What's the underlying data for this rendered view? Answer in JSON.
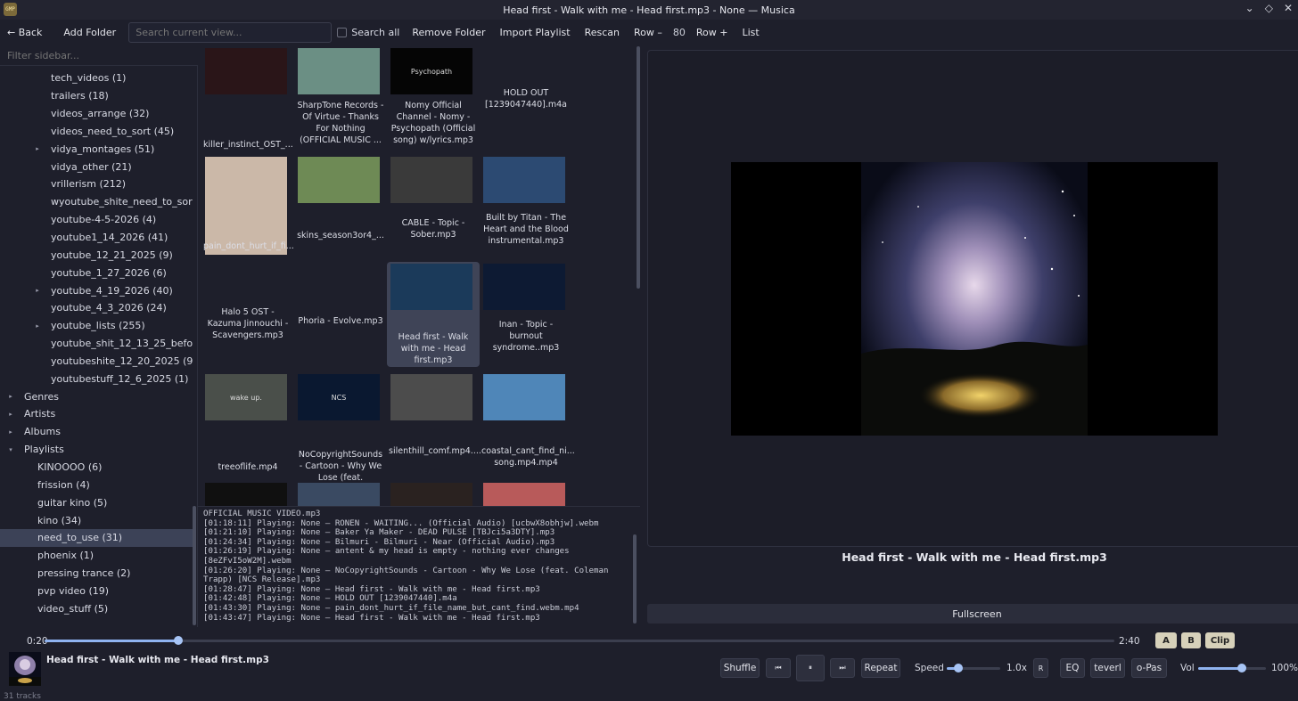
{
  "window": {
    "title": "Head first - Walk with me - Head first.mp3 - None — Musica",
    "app_icon_label": "GMP"
  },
  "toolbar": {
    "back": "← Back",
    "add_folder": "Add Folder",
    "search_placeholder": "Search current view...",
    "search_all": "Search all",
    "remove_folder": "Remove Folder",
    "import_playlist": "Import Playlist",
    "rescan": "Rescan",
    "row_minus": "Row –",
    "row_count": "80",
    "row_plus": "Row +",
    "list": "List"
  },
  "sidebar": {
    "filter_placeholder": "Filter sidebar...",
    "items": [
      {
        "label": "tech_videos (1)"
      },
      {
        "label": "trailers (18)"
      },
      {
        "label": "videos_arrange (32)"
      },
      {
        "label": "videos_need_to_sort (45)"
      },
      {
        "label": "vidya_montages (51)"
      },
      {
        "label": "vidya_other (21)"
      },
      {
        "label": "vrillerism (212)"
      },
      {
        "label": "wyoutube_shite_need_to_sort..."
      },
      {
        "label": "youtube-4-5-2026 (4)"
      },
      {
        "label": "youtube1_14_2026 (41)"
      },
      {
        "label": "youtube_12_21_2025 (9)"
      },
      {
        "label": "youtube_1_27_2026 (6)"
      },
      {
        "label": "youtube_4_19_2026 (40)"
      },
      {
        "label": "youtube_4_3_2026 (24)"
      },
      {
        "label": "youtube_lists (255)"
      },
      {
        "label": "youtube_shit_12_13_25_befor..."
      },
      {
        "label": "youtubeshite_12_20_2025 (9)"
      },
      {
        "label": "youtubestuff_12_6_2025 (1)"
      },
      {
        "label": "Genres"
      },
      {
        "label": "Artists"
      },
      {
        "label": "Albums"
      },
      {
        "label": "Playlists"
      },
      {
        "label": "KINOOOO (6)"
      },
      {
        "label": "frission (4)"
      },
      {
        "label": "guitar kino (5)"
      },
      {
        "label": "kino (34)"
      },
      {
        "label": "need_to_use (31)"
      },
      {
        "label": "phoenix (1)"
      },
      {
        "label": "pressing trance (2)"
      },
      {
        "label": "pvp video (19)"
      },
      {
        "label": "video_stuff (5)"
      }
    ]
  },
  "grid": {
    "cards": [
      {
        "caption": "killer_instinct_OST_...",
        "thumb_color": "#2a1518"
      },
      {
        "caption": "SharpTone Records - Of Virtue - Thanks For Nothing (OFFICIAL MUSIC ...",
        "thumb_color": "#6b8f84"
      },
      {
        "caption": "Nomy Official Channel - Nomy - Psychopath (Official song) w/lyrics.mp3",
        "thumb_color": "#050505",
        "thumb_text": "Psychopath"
      },
      {
        "caption": "HOLD OUT [1239047440].m4a",
        "thumb_color": ""
      },
      {
        "caption": "pain_dont_hurt_if_fi...",
        "thumb_color": "#cbb8a8"
      },
      {
        "caption": "skins_season3or4_...",
        "thumb_color": "#6e8a55"
      },
      {
        "caption": "CABLE - Topic - Sober.mp3",
        "thumb_color": "#3a3a3a"
      },
      {
        "caption": "Built by Titan - The Heart and the Blood instrumental.mp3",
        "thumb_color": "#2c4a72"
      },
      {
        "caption": "Halo 5 OST - Kazuma Jinnouchi - Scavengers.mp3",
        "thumb_color": ""
      },
      {
        "caption": "Phoria - Evolve.mp3",
        "thumb_color": ""
      },
      {
        "caption": "Head first - Walk with me - Head first.mp3",
        "thumb_color": "#1b3a5a"
      },
      {
        "caption": "Inan - Topic - burnout syndrome..mp3",
        "thumb_color": "#0d1a33"
      },
      {
        "caption": "treeoflife.mp4",
        "thumb_color": "#4a4f4a",
        "thumb_text": "wake up."
      },
      {
        "caption": "NoCopyrightSounds - Cartoon - Why We Lose (feat. Coleman...",
        "thumb_color": "#0a1830",
        "thumb_text": "NCS"
      },
      {
        "caption": "silenthill_comf.mp4....",
        "thumb_color": "#4c4c4c"
      },
      {
        "caption": "coastal_cant_find_ni... song.mp4.mp4",
        "thumb_color": "#4f86b8"
      },
      {
        "caption": "",
        "thumb_color": "#101010"
      },
      {
        "caption": "",
        "thumb_color": "#3a4a62"
      },
      {
        "caption": "",
        "thumb_color": "#2a2220"
      },
      {
        "caption": "",
        "thumb_color": "#b85a5a"
      }
    ]
  },
  "log": {
    "lines": [
      "OFFICIAL MUSIC VIDEO.mp3",
      "[01:18:11] Playing: None — RONEN - WAITING... (Official Audio) [ucbwX8obhjw].webm",
      "[01:21:10] Playing: None — Baker Ya Maker - DEAD PULSE [TBJci5a3DTY].mp3",
      "[01:24:34] Playing: None — Bilmuri - Bilmuri - Near (Official Audio).mp3",
      "[01:26:19] Playing: None — antent & my head is empty - nothing ever changes",
      "[8eZFvI5oW2M].webm",
      "[01:26:20] Playing: None — NoCopyrightSounds - Cartoon - Why We Lose (feat. Coleman",
      "Trapp) [NCS Release].mp3",
      "[01:28:47] Playing: None — Head first - Walk with me - Head first.mp3",
      "[01:42:48] Playing: None — HOLD OUT [1239047440].m4a",
      "[01:43:30] Playing: None — pain_dont_hurt_if_file_name_but_cant_find.webm.mp4",
      "[01:43:47] Playing: None — Head first - Walk with me - Head first.mp3"
    ]
  },
  "preview": {
    "now_playing_title": "Head first - Walk with me - Head first.mp3",
    "fullscreen": "Fullscreen"
  },
  "seek": {
    "current": "0:20",
    "total": "2:40",
    "progress": 0.125,
    "a": "A",
    "b": "B",
    "clip": "Clip"
  },
  "player": {
    "title": "Head first - Walk with me - Head first.mp3",
    "track_count": "31 tracks",
    "shuffle": "Shuffle",
    "prev_icon": "⏮",
    "pause_icon": "⏸",
    "next_icon": "⏭",
    "repeat": "Repeat",
    "speed_label": "Speed",
    "speed_value": "1.0x",
    "speed_reset_icon": "R",
    "speed_level": 0.22,
    "eq": "EQ",
    "reverb": "teverl",
    "auto_pass": "o-Pas",
    "vol_label": "Vol",
    "vol_value": "100%",
    "vol_level": 0.65
  },
  "colors": {
    "accent": "#8fb3f0",
    "selection": "#3c4257",
    "ab_button": "#d7d1ba"
  }
}
